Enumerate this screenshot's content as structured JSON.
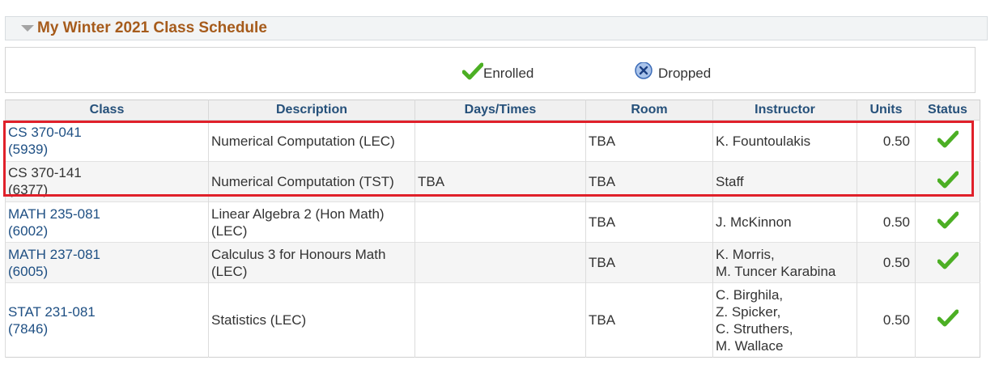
{
  "section": {
    "title": "My Winter 2021 Class Schedule"
  },
  "legend": {
    "enrolled": "Enrolled",
    "dropped": "Dropped"
  },
  "table": {
    "headers": {
      "class": "Class",
      "description": "Description",
      "days_times": "Days/Times",
      "room": "Room",
      "instructor": "Instructor",
      "units": "Units",
      "status": "Status"
    },
    "rows": [
      {
        "class_code": "CS 370-041",
        "class_number": "(5939)",
        "description": "Numerical Computation (LEC)",
        "days_times": "",
        "room": "TBA",
        "instructor": "K. Fountoulakis",
        "units": "0.50",
        "status": "Enrolled"
      },
      {
        "class_code": "CS 370-141",
        "class_number": "(6377)",
        "description": "Numerical Computation (TST)",
        "days_times": "TBA",
        "room": "TBA",
        "instructor": "Staff",
        "units": "",
        "status": "Enrolled"
      },
      {
        "class_code": "MATH 235-081",
        "class_number": "(6002)",
        "description": "Linear Algebra 2 (Hon Math) (LEC)",
        "days_times": "",
        "room": "TBA",
        "instructor": "J. McKinnon",
        "units": "0.50",
        "status": "Enrolled"
      },
      {
        "class_code": "MATH 237-081",
        "class_number": "(6005)",
        "description": "Calculus 3 for Honours Math (LEC)",
        "days_times": "",
        "room": "TBA",
        "instructor": "K. Morris,\nM. Tuncer Karabina",
        "units": "0.50",
        "status": "Enrolled"
      },
      {
        "class_code": "STAT 231-081",
        "class_number": "(7846)",
        "description": "Statistics (LEC)",
        "days_times": "",
        "room": "TBA",
        "instructor": "C. Birghila,\nZ. Spicker,\nC. Struthers,\nM. Wallace",
        "units": "0.50",
        "status": "Enrolled"
      }
    ]
  },
  "colors": {
    "title": "#a65b1b",
    "link": "#1e4f83",
    "header_text": "#25507a",
    "check": "#4caf24",
    "highlight": "#e0202a"
  },
  "icons": {
    "enrolled": "green-check-icon",
    "dropped": "blue-x-circle-icon",
    "collapse": "triangle-down-icon"
  }
}
